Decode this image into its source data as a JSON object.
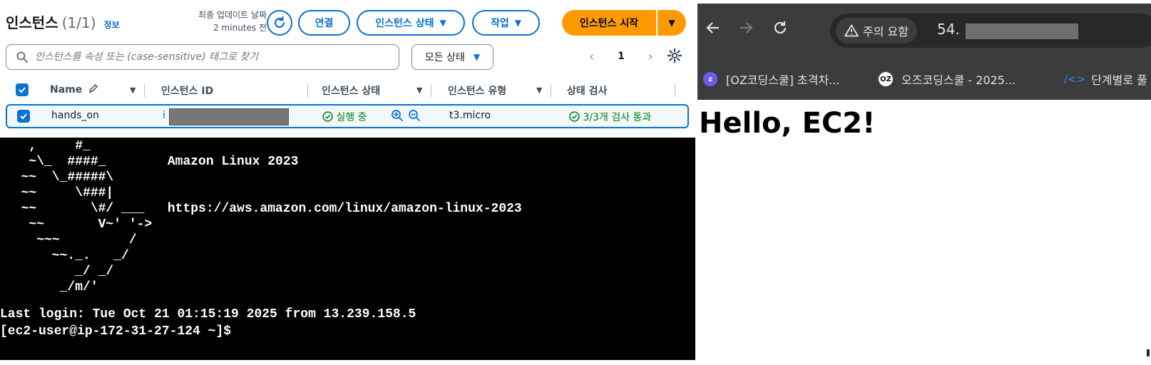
{
  "aws": {
    "title": "인스턴스",
    "count": "(1/1)",
    "info_link": "정보",
    "last_update_label": "최종 업데이트 날짜",
    "last_update_value": "2 minutes 전",
    "buttons": {
      "connect": "연결",
      "instance_state": "인스턴스 상태",
      "actions": "작업",
      "launch": "인스턴스 시작"
    },
    "search_placeholder": "인스턴스를 속성 또는 (case-sensitive) 태그로 찾기",
    "status_filter": "모든 상태",
    "page_number": "1",
    "columns": [
      "Name",
      "인스턴스 ID",
      "인스턴스 상태",
      "인스턴스 유형",
      "상태 검사"
    ],
    "row": {
      "name": "hands_on",
      "instance_id_prefix": "i",
      "state": "실행 중",
      "type": "t3.micro",
      "status_check": "3/3개 검사 통과"
    }
  },
  "terminal": {
    "ascii_art": [
      "   ,     #_",
      "   ~\\_  ####_        Amazon Linux 2023",
      "  ~~  \\_#####\\",
      "  ~~     \\###|",
      "  ~~       \\#/ ___   https://aws.amazon.com/linux/amazon-linux-2023",
      "   ~~       V~' '->",
      "    ~~~         /",
      "      ~~._.   _/",
      "         _/ _/",
      "       _/m/'"
    ],
    "last_login": "Last login: Tue Oct 21 01:15:19 2025 from 13.239.158.5",
    "prompt": "[ec2-user@ip-172-31-27-124 ~]$"
  },
  "browser": {
    "security_chip": "주의 요함",
    "url_prefix": "54.",
    "bookmarks": [
      {
        "label": "[OZ코딩스쿨] 초격차...",
        "icon": "z-badge-icon",
        "color": "#6b5bf5"
      },
      {
        "label": "오즈코딩스쿨 - 2025...",
        "icon": "oz-badge-icon",
        "color": "#111111"
      },
      {
        "label": "단계별로 풀",
        "icon": "code-brackets-icon",
        "color": "#3b82f6"
      }
    ],
    "page_heading": "Hello, EC2!"
  }
}
